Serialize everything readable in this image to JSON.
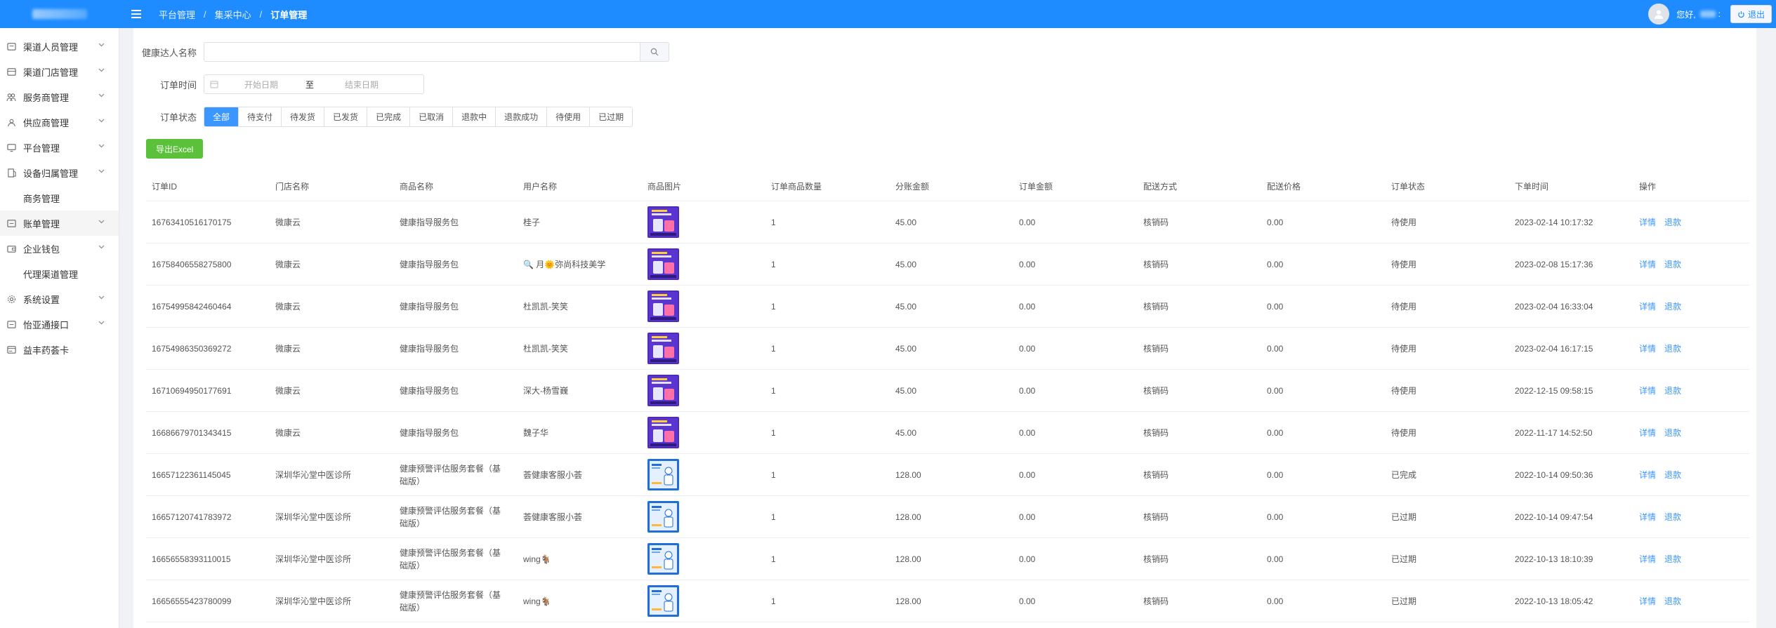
{
  "header": {
    "breadcrumbs": [
      "平台管理",
      "集采中心",
      "订单管理"
    ],
    "greeting": "您好,",
    "greeting_suffix": ":",
    "logout_label": "退出",
    "bar_color": "#1e8cff"
  },
  "sidebar": {
    "items": [
      {
        "label": "渠道人员管理",
        "icon": "users-icon",
        "has_children": true
      },
      {
        "label": "渠道门店管理",
        "icon": "store-icon",
        "has_children": true
      },
      {
        "label": "服务商管理",
        "icon": "people-icon",
        "has_children": true
      },
      {
        "label": "供应商管理",
        "icon": "supplier-icon",
        "has_children": true
      },
      {
        "label": "平台管理",
        "icon": "monitor-icon",
        "has_children": true
      },
      {
        "label": "设备归属管理",
        "icon": "device-icon",
        "has_children": true
      },
      {
        "label": "商务管理",
        "icon": "briefcase-icon",
        "has_children": false
      },
      {
        "label": "账单管理",
        "icon": "bill-icon",
        "has_children": true
      },
      {
        "label": "企业钱包",
        "icon": "wallet-icon",
        "has_children": true
      },
      {
        "label": "代理渠道管理",
        "icon": "agent-icon",
        "has_children": false
      },
      {
        "label": "系统设置",
        "icon": "gear-icon",
        "has_children": true
      },
      {
        "label": "怡亚通接口",
        "icon": "api-icon",
        "has_children": true
      },
      {
        "label": "益丰药荟卡",
        "icon": "card-icon",
        "has_children": false
      }
    ]
  },
  "filters": {
    "name_label": "健康达人名称",
    "name_value": "",
    "time_label": "订单时间",
    "start_placeholder": "开始日期",
    "range_sep": "至",
    "end_placeholder": "结束日期",
    "status_label": "订单状态",
    "status_options": [
      "全部",
      "待支付",
      "待发货",
      "已发货",
      "已完成",
      "已取消",
      "退款中",
      "退款成功",
      "待使用",
      "已过期"
    ],
    "status_selected": "全部"
  },
  "export_label": "导出Excel",
  "table": {
    "columns": [
      "订单ID",
      "门店名称",
      "商品名称",
      "用户名称",
      "商品图片",
      "订单商品数量",
      "分账金额",
      "订单金额",
      "配送方式",
      "配送价格",
      "订单状态",
      "下单时间",
      "操作"
    ],
    "detail_label": "详情",
    "refund_label": "退款",
    "rows": [
      {
        "id": "16763410516170175",
        "store": "微康云",
        "product": "健康指导服务包",
        "user": "桂子",
        "image": "purple",
        "qty": "1",
        "split": "45.00",
        "amount": "0.00",
        "delivery": "核销码",
        "delivery_price": "0.00",
        "status": "待使用",
        "time": "2023-02-14 10:17:32"
      },
      {
        "id": "16758406558275800",
        "store": "微康云",
        "product": "健康指导服务包",
        "user": "🔍 月🌞弥尚科技美学",
        "image": "purple",
        "qty": "1",
        "split": "45.00",
        "amount": "0.00",
        "delivery": "核销码",
        "delivery_price": "0.00",
        "status": "待使用",
        "time": "2023-02-08 15:17:36"
      },
      {
        "id": "16754995842460464",
        "store": "微康云",
        "product": "健康指导服务包",
        "user": "杜凯凯-笑笑",
        "image": "purple",
        "qty": "1",
        "split": "45.00",
        "amount": "0.00",
        "delivery": "核销码",
        "delivery_price": "0.00",
        "status": "待使用",
        "time": "2023-02-04 16:33:04"
      },
      {
        "id": "16754986350369272",
        "store": "微康云",
        "product": "健康指导服务包",
        "user": "杜凯凯-笑笑",
        "image": "purple",
        "qty": "1",
        "split": "45.00",
        "amount": "0.00",
        "delivery": "核销码",
        "delivery_price": "0.00",
        "status": "待使用",
        "time": "2023-02-04 16:17:15"
      },
      {
        "id": "16710694950177691",
        "store": "微康云",
        "product": "健康指导服务包",
        "user": "深大-杨雪巍",
        "image": "purple",
        "qty": "1",
        "split": "45.00",
        "amount": "0.00",
        "delivery": "核销码",
        "delivery_price": "0.00",
        "status": "待使用",
        "time": "2022-12-15 09:58:15"
      },
      {
        "id": "16686679701343415",
        "store": "微康云",
        "product": "健康指导服务包",
        "user": "魏子华",
        "image": "purple",
        "qty": "1",
        "split": "45.00",
        "amount": "0.00",
        "delivery": "核销码",
        "delivery_price": "0.00",
        "status": "待使用",
        "time": "2022-11-17 14:52:50"
      },
      {
        "id": "16657122361145045",
        "store": "深圳华沁堂中医诊所",
        "product": "健康预警评估服务套餐（基础版）",
        "user": "荟健康客服小荟",
        "image": "blue",
        "qty": "1",
        "split": "128.00",
        "amount": "0.00",
        "delivery": "核销码",
        "delivery_price": "0.00",
        "status": "已完成",
        "time": "2022-10-14 09:50:36"
      },
      {
        "id": "16657120741783972",
        "store": "深圳华沁堂中医诊所",
        "product": "健康预警评估服务套餐（基础版）",
        "user": "荟健康客服小荟",
        "image": "blue",
        "qty": "1",
        "split": "128.00",
        "amount": "0.00",
        "delivery": "核销码",
        "delivery_price": "0.00",
        "status": "已过期",
        "time": "2022-10-14 09:47:54"
      },
      {
        "id": "16656558393110015",
        "store": "深圳华沁堂中医诊所",
        "product": "健康预警评估服务套餐（基础版）",
        "user": "wing🐐",
        "image": "blue",
        "qty": "1",
        "split": "128.00",
        "amount": "0.00",
        "delivery": "核销码",
        "delivery_price": "0.00",
        "status": "已过期",
        "time": "2022-10-13 18:10:39"
      },
      {
        "id": "16656555423780099",
        "store": "深圳华沁堂中医诊所",
        "product": "健康预警评估服务套餐（基础版）",
        "user": "wing🐐",
        "image": "blue",
        "qty": "1",
        "split": "128.00",
        "amount": "0.00",
        "delivery": "核销码",
        "delivery_price": "0.00",
        "status": "已过期",
        "time": "2022-10-13 18:05:42"
      }
    ]
  }
}
